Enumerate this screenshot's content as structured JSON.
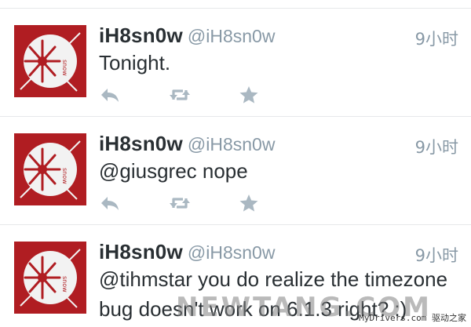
{
  "tweets": [
    {
      "display_name": "iH8sn0w",
      "screen_name": "@iH8sn0w",
      "time": "9小时",
      "text": "Tonight."
    },
    {
      "display_name": "iH8sn0w",
      "screen_name": "@iH8sn0w",
      "time": "9小时",
      "text": "@giusgrec nope"
    },
    {
      "display_name": "iH8sn0w",
      "screen_name": "@iH8sn0w",
      "time": "9小时",
      "text": "@tihmstar you do realize the timezone bug doesn't work on 6.1.3 right? :)"
    }
  ],
  "icons": {
    "reply": "reply-icon",
    "retweet": "retweet-icon",
    "favorite": "star-icon",
    "avatar": "snowflake-logo-icon"
  },
  "colors": {
    "avatar_bg": "#b01d22",
    "action_icon": "#aab8c2",
    "secondary_text": "#8899a6",
    "primary_text": "#292f33"
  },
  "watermark": "NEWTANG.COM",
  "site_mark": "MyDrivers.com 驱动之家"
}
